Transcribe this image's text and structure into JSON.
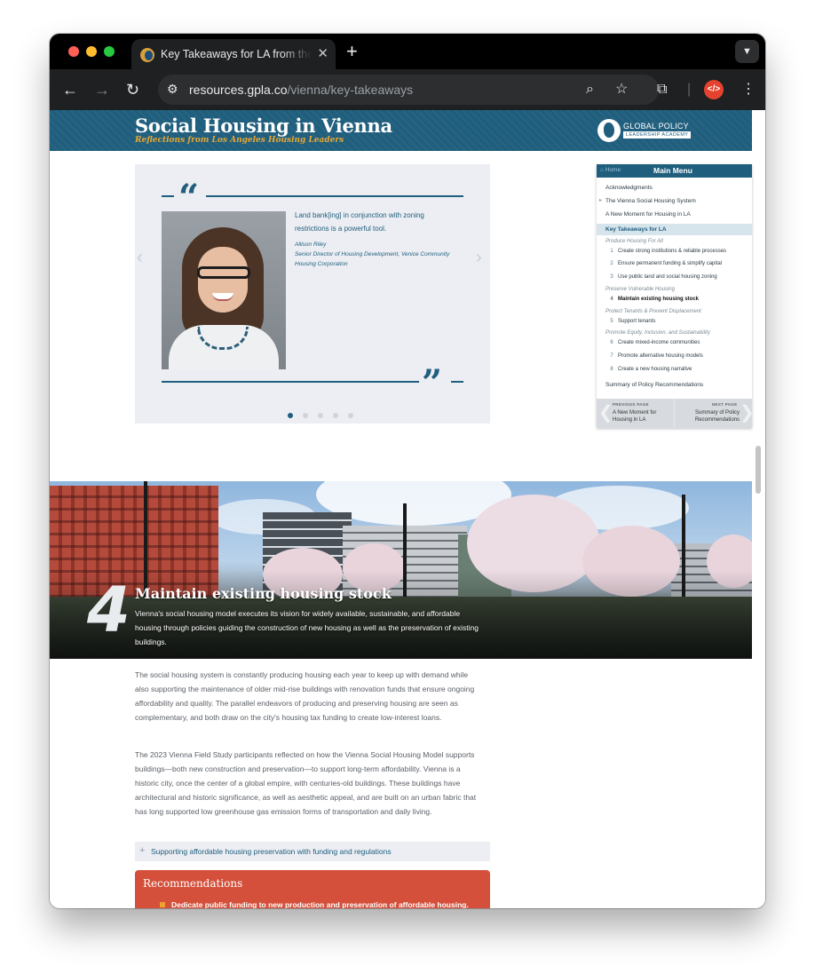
{
  "browser": {
    "tab_title": "Key Takeaways for LA from the Vienna Social Housing Field Study",
    "url_host": "resources.gpla.co",
    "url_path": "/vienna/key-takeaways",
    "colors": {
      "close": "#ff5f57",
      "minimize": "#febc2e",
      "zoom": "#28c840"
    }
  },
  "site": {
    "title": "Social Housing in Vienna",
    "subtitle": "Reflections from Los Angeles Housing Leaders",
    "logo_line1": "GLOBAL POLICY",
    "logo_line2": "LEADERSHIP ACADEMY",
    "brand_color": "#1f5e7d"
  },
  "testimonial": {
    "quote": "Land bank[ing] in conjunction with zoning restrictions is a powerful tool.",
    "author_name": "Allison Riley",
    "author_role": "Senior Director of Housing Development, Venice Community Housing Corporation",
    "slide_count": 5,
    "active_slide": 1
  },
  "menu": {
    "home_label": "Home",
    "title": "Main Menu",
    "items": [
      "Acknowledgments",
      "The Vienna Social Housing System",
      "A New Moment for Housing in LA",
      "Key Takeaways for LA"
    ],
    "categories": {
      "produce": "Produce Housing For All",
      "preserve": "Preserve Vulnerable Housing",
      "protect": "Protect Tenants & Prevent Displacement",
      "promote": "Promote Equity, Inclusion, and Sustainability"
    },
    "subitems": [
      {
        "num": "1",
        "label": "Create strong institutions & reliable processes"
      },
      {
        "num": "2",
        "label": "Ensure permanent funding & simplify capital"
      },
      {
        "num": "3",
        "label": "Use public land and social housing zoning"
      },
      {
        "num": "4",
        "label": "Maintain existing housing stock"
      },
      {
        "num": "5",
        "label": "Support tenants"
      },
      {
        "num": "6",
        "label": "Create mixed-income communities"
      },
      {
        "num": "7",
        "label": "Promote alternative housing models"
      },
      {
        "num": "8",
        "label": "Create a new housing narrative"
      }
    ],
    "summary": "Summary of Policy Recommendations",
    "prev_label": "PREVIOUS PAGE",
    "prev_text": "A New Moment for Housing in LA",
    "next_label": "NEXT PAGE",
    "next_text": "Summary of Policy Recommendations"
  },
  "section": {
    "number": "4",
    "title": "Maintain existing housing stock",
    "intro": "Vienna's social housing model executes its vision for widely available, sustainable, and affordable housing through policies guiding the construction of new housing as well as the preservation of existing buildings.",
    "para1": "The social housing system is constantly producing housing each year to keep up with demand while also supporting the maintenance of older mid-rise buildings with renovation funds that ensure ongoing affordability and quality. The parallel endeavors of producing and preserving housing are seen as complementary, and both draw on the city's housing tax funding to create low-interest loans.",
    "para2": "The 2023 Vienna Field Study participants reflected on how the Vienna Social Housing Model supports buildings—both new construction and preservation—to support long-term affordability. Vienna is a historic city, once the center of a global empire, with centuries-old buildings. These buildings have architectural and historic significance, as well as aesthetic appeal, and are built on an urban fabric that has long supported low greenhouse gas emission forms of transportation and daily living.",
    "accordion_label": "Supporting affordable housing preservation with funding and regulations",
    "reco_title": "Recommendations",
    "reco_item1": "Dedicate public funding to new production and preservation of affordable housing.",
    "reco_color": "#d4503b"
  }
}
